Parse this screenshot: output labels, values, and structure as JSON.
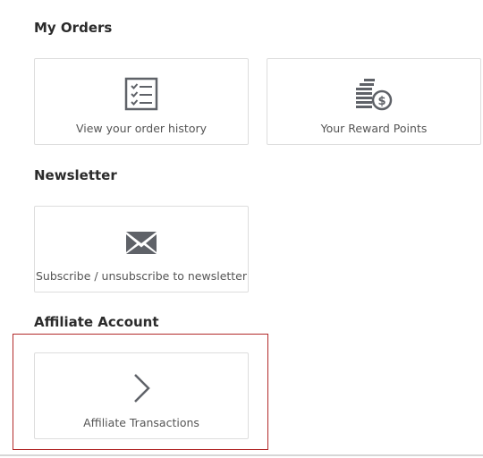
{
  "sections": {
    "orders": {
      "title": "My Orders",
      "tiles": [
        {
          "label": "View your order history",
          "icon": "order-history-list-icon"
        },
        {
          "label": "Your Reward Points",
          "icon": "reward-points-coins-icon"
        }
      ]
    },
    "newsletter": {
      "title": "Newsletter",
      "tiles": [
        {
          "label": "Subscribe / unsubscribe to newsletter",
          "icon": "envelope-icon"
        }
      ]
    },
    "affiliate": {
      "title": "Affiliate Account",
      "tiles": [
        {
          "label": "Affiliate Transactions",
          "icon": "chevron-right-icon"
        }
      ]
    }
  },
  "colors": {
    "tile_border": "#dddddd",
    "icon": "#5f6268",
    "highlight_border": "#b22a2a"
  }
}
